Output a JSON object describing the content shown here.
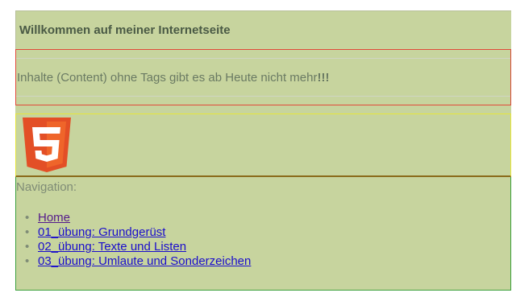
{
  "header": {
    "title": "Willkommen auf meiner Internetseite"
  },
  "content": {
    "text": "Inhalte (Content) ohne Tags gibt es ab Heute nicht mehr",
    "emphasis": "!!!"
  },
  "logo": {
    "icon": "html5-logo-icon",
    "glyph": "5",
    "colors": {
      "shield": "#e34f26",
      "shield_light": "#ef652a",
      "glyph": "#ffffff"
    }
  },
  "navigation": {
    "label": "Navigation:",
    "bullet": "•",
    "items": [
      {
        "label": "Home",
        "visited": true
      },
      {
        "label": "01_übung: Grundgerüst",
        "visited": false
      },
      {
        "label": "02_übung: Texte und Listen",
        "visited": false
      },
      {
        "label": "03_übung: Umlaute und Sonderzeichen",
        "visited": false
      }
    ]
  },
  "colors": {
    "page_background": "#c7d49e",
    "content_border": "#e24a3a",
    "logo_border": "#e7e63c",
    "nav_border": "#3da03d",
    "link": "#1a0dcc",
    "link_visited": "#551a8b"
  }
}
